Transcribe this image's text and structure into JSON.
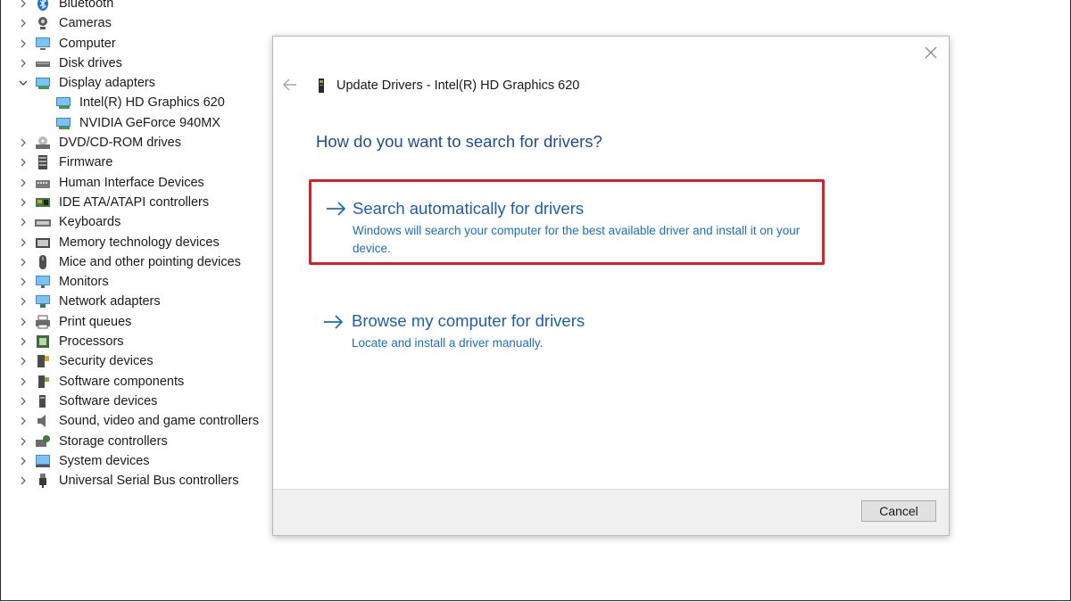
{
  "device_tree": {
    "items": [
      {
        "label": "Bluetooth",
        "icon": "bluetooth-icon",
        "expanded": false,
        "level": 0
      },
      {
        "label": "Cameras",
        "icon": "camera-icon",
        "expanded": false,
        "level": 0
      },
      {
        "label": "Computer",
        "icon": "computer-icon",
        "expanded": false,
        "level": 0
      },
      {
        "label": "Disk drives",
        "icon": "disk-drive-icon",
        "expanded": false,
        "level": 0
      },
      {
        "label": "Display adapters",
        "icon": "display-adapter-icon",
        "expanded": true,
        "level": 0
      },
      {
        "label": "Intel(R) HD Graphics 620",
        "icon": "display-adapter-icon",
        "level": 1
      },
      {
        "label": "NVIDIA GeForce 940MX",
        "icon": "display-adapter-icon",
        "level": 1
      },
      {
        "label": "DVD/CD-ROM drives",
        "icon": "dvd-drive-icon",
        "expanded": false,
        "level": 0
      },
      {
        "label": "Firmware",
        "icon": "firmware-icon",
        "expanded": false,
        "level": 0
      },
      {
        "label": "Human Interface Devices",
        "icon": "hid-icon",
        "expanded": false,
        "level": 0
      },
      {
        "label": "IDE ATA/ATAPI controllers",
        "icon": "ide-controller-icon",
        "expanded": false,
        "level": 0
      },
      {
        "label": "Keyboards",
        "icon": "keyboard-icon",
        "expanded": false,
        "level": 0
      },
      {
        "label": "Memory technology devices",
        "icon": "memory-icon",
        "expanded": false,
        "level": 0
      },
      {
        "label": "Mice and other pointing devices",
        "icon": "mouse-icon",
        "expanded": false,
        "level": 0
      },
      {
        "label": "Monitors",
        "icon": "monitor-icon",
        "expanded": false,
        "level": 0
      },
      {
        "label": "Network adapters",
        "icon": "network-adapter-icon",
        "expanded": false,
        "level": 0
      },
      {
        "label": "Print queues",
        "icon": "printer-icon",
        "expanded": false,
        "level": 0
      },
      {
        "label": "Processors",
        "icon": "processor-icon",
        "expanded": false,
        "level": 0
      },
      {
        "label": "Security devices",
        "icon": "security-device-icon",
        "expanded": false,
        "level": 0
      },
      {
        "label": "Software components",
        "icon": "software-component-icon",
        "expanded": false,
        "level": 0
      },
      {
        "label": "Software devices",
        "icon": "software-device-icon",
        "expanded": false,
        "level": 0
      },
      {
        "label": "Sound, video and game controllers",
        "icon": "speaker-icon",
        "expanded": false,
        "level": 0
      },
      {
        "label": "Storage controllers",
        "icon": "storage-controller-icon",
        "expanded": false,
        "level": 0
      },
      {
        "label": "System devices",
        "icon": "system-device-icon",
        "expanded": false,
        "level": 0
      },
      {
        "label": "Universal Serial Bus controllers",
        "icon": "usb-icon",
        "expanded": false,
        "level": 0
      }
    ]
  },
  "dialog": {
    "title": "Update Drivers - Intel(R) HD Graphics 620",
    "question": "How do you want to search for drivers?",
    "options": [
      {
        "title": "Search automatically for drivers",
        "description": "Windows will search your computer for the best available driver and install it on your device."
      },
      {
        "title": "Browse my computer for drivers",
        "description": "Locate and install a driver manually."
      }
    ],
    "cancel_label": "Cancel"
  },
  "colors": {
    "link_blue": "#1c5fa8",
    "heading_blue": "#1c4e8e",
    "highlight_red": "#d9202a",
    "footer_gray": "#f0f0f0"
  }
}
